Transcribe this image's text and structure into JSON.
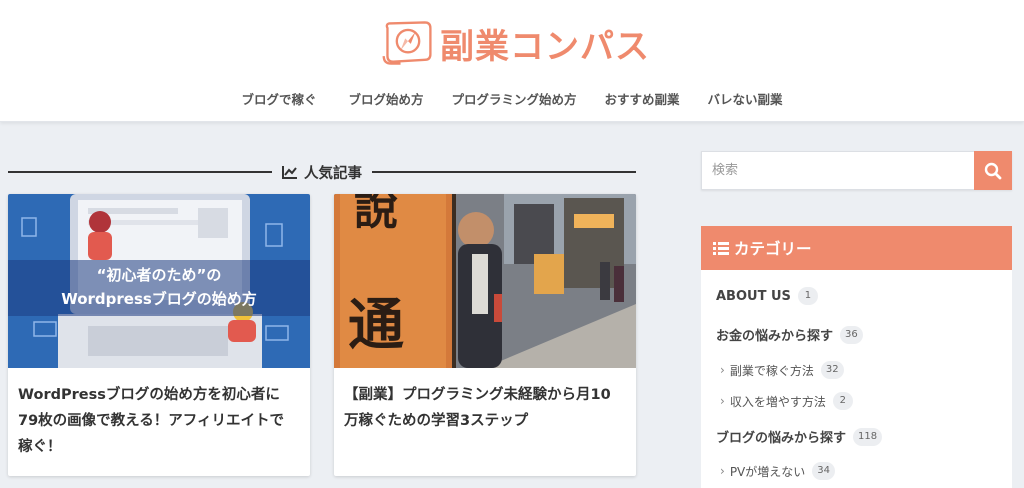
{
  "header": {
    "site_name": "副業コンパス",
    "nav": [
      "ブログで稼ぐ",
      "ブログ始め方",
      "プログラミング始め方",
      "おすすめ副業",
      "バレない副業"
    ]
  },
  "main": {
    "section_title": "人気記事",
    "cards": [
      {
        "thumb_line1": "“初心者のため”の",
        "thumb_line2": "Wordpressブログの始め方",
        "title": "WordPressブログの始め方を初心者に79枚の画像で教える！アフィリエイトで稼ぐ！"
      },
      {
        "title": "【副業】プログラミング未経験から月10万稼ぐための学習3ステップ"
      }
    ]
  },
  "sidebar": {
    "search_placeholder": "検索",
    "category_title": "カテゴリー",
    "categories": [
      {
        "label": "ABOUT US",
        "count": "1"
      },
      {
        "label": "お金の悩みから探す",
        "count": "36"
      },
      {
        "label": "副業で稼ぐ方法",
        "count": "32"
      },
      {
        "label": "収入を増やす方法",
        "count": "2"
      },
      {
        "label": "ブログの悩みから探す",
        "count": "118"
      },
      {
        "label": "PVが増えない",
        "count": "34"
      }
    ]
  },
  "colors": {
    "accent": "#ef8a6d",
    "background": "#eceff3"
  },
  "icons": [
    "logo-compass-icon",
    "trend-chart-icon",
    "search-icon",
    "list-icon",
    "chevron-right-icon"
  ]
}
